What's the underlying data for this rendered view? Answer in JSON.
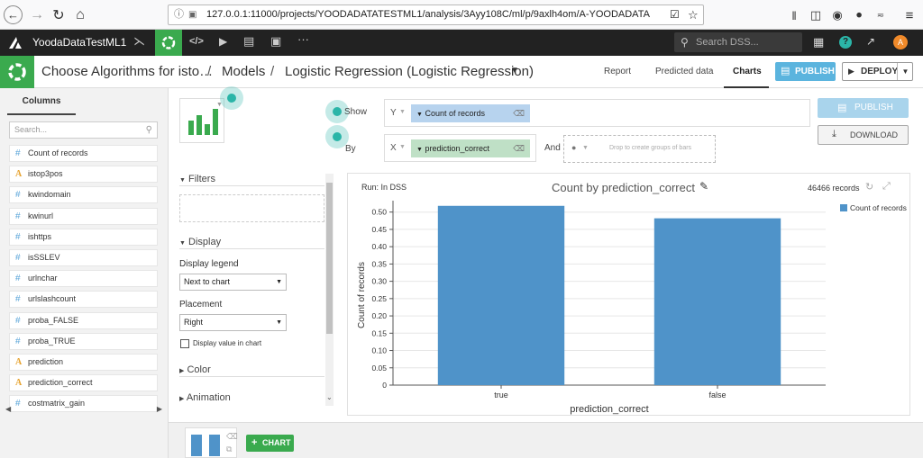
{
  "browser": {
    "url": "127.0.0.1:11000/projects/YOODADATATESTML1/analysis/3Ayy108C/ml/p/9axlh4om/A-YOODADATA"
  },
  "dss": {
    "project_name": "YoodaDataTestML1",
    "search_placeholder": "Search DSS...",
    "avatar_letter": "A"
  },
  "titlebar": {
    "crumb1": "Choose Algorithms for isto…",
    "sep1": "/",
    "crumb2": "Models",
    "sep2": "/",
    "crumb3": "Logistic Regression (Logistic Regression)",
    "tabs": [
      "Report",
      "Predicted data",
      "Charts"
    ],
    "publish": "PUBLISH",
    "deploy": "DEPLOY"
  },
  "columns": {
    "tab": "Columns",
    "search_placeholder": "Search...",
    "items": [
      {
        "type": "#",
        "name": "Count of records"
      },
      {
        "type": "A",
        "name": "istop3pos"
      },
      {
        "type": "#",
        "name": "kwindomain"
      },
      {
        "type": "#",
        "name": "kwinurl"
      },
      {
        "type": "#",
        "name": "ishttps"
      },
      {
        "type": "#",
        "name": "isSSLEV"
      },
      {
        "type": "#",
        "name": "urlnchar"
      },
      {
        "type": "#",
        "name": "urlslashcount"
      },
      {
        "type": "#",
        "name": "proba_FALSE"
      },
      {
        "type": "#",
        "name": "proba_TRUE"
      },
      {
        "type": "A",
        "name": "prediction"
      },
      {
        "type": "A",
        "name": "prediction_correct"
      },
      {
        "type": "#",
        "name": "costmatrix_gain"
      }
    ]
  },
  "config": {
    "show": "Show",
    "by": "By",
    "y_letter": "Y",
    "y_chip": "Count of records",
    "x_letter": "X",
    "x_chip": "prediction_correct",
    "and": "And",
    "drop_hint": "Drop to create groups of bars",
    "publish": "PUBLISH",
    "download": "DOWNLOAD",
    "filters": "Filters",
    "display": "Display",
    "display_legend_label": "Display legend",
    "display_legend_value": "Next to chart",
    "placement_label": "Placement",
    "placement_value": "Right",
    "display_value_label": "Display value in chart",
    "color": "Color",
    "animation": "Animation",
    "add_chart": "CHART"
  },
  "chart_header": {
    "run": "Run: In DSS",
    "records": "46466 records"
  },
  "colors": {
    "bar": "#4f93c9",
    "accent": "#2bb5a8",
    "green": "#3aaa4e"
  },
  "chart_data": {
    "type": "bar",
    "title": "Count by prediction_correct",
    "xlabel": "prediction_correct",
    "ylabel": "Count of records",
    "categories": [
      "true",
      "false"
    ],
    "series": [
      {
        "name": "Count of records",
        "values": [
          0.518,
          0.482
        ]
      }
    ],
    "ylim": [
      0,
      0.52
    ],
    "yticks": [
      "0",
      "0.05",
      "0.10",
      "0.15",
      "0.20",
      "0.25",
      "0.30",
      "0.35",
      "0.40",
      "0.45",
      "0.50"
    ],
    "ytick_values": [
      0,
      0.05,
      0.1,
      0.15,
      0.2,
      0.25,
      0.3,
      0.35,
      0.4,
      0.45,
      0.5
    ],
    "legend": "right",
    "grid": true
  }
}
